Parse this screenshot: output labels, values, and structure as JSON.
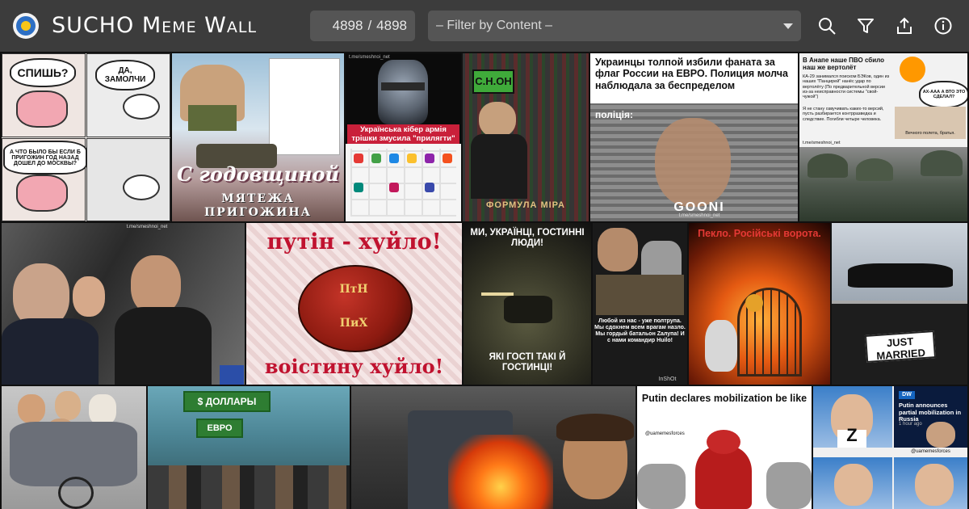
{
  "header": {
    "app_title": "SUCHO Meme Wall",
    "count_shown": "4898",
    "count_separator": "/",
    "count_total": "4898",
    "filter_placeholder": "– Filter by Content –",
    "icons": [
      "search-icon",
      "filter-icon",
      "share-icon",
      "info-icon"
    ]
  },
  "colors": {
    "header_bg": "#3c3c3c",
    "control_bg": "#555555",
    "text": "#ffffff"
  },
  "memes": [
    {
      "id": "brain-sleep",
      "speech_1": "СПИШЬ?",
      "speech_2": "ДА, ЗАМОЛЧИ",
      "speech_3": "А ЧТО БЫЛО БЫ ЕСЛИ Б ПРИГОЖИН ГОД НАЗАД ДОШЕЛ ДО МОСКВЫ?"
    },
    {
      "id": "mutiny-anniversary",
      "caption_1": "С годовщиной",
      "caption_2": "МЯТЕЖА",
      "caption_3": "ПРИГОЖИНА"
    },
    {
      "id": "robocop-army",
      "caption": "Українська кібер армія трішки змусила \"прилягти\"",
      "watermark": "t.me/smeshnoi_net"
    },
    {
      "id": "formula-mira",
      "sign": "С.Н.ОН",
      "caption": "ФОРМУЛА МІРА"
    },
    {
      "id": "euro-fan",
      "caption": "Украинцы толпой избили фаната за флаг России на ЕВРО. Полиция молча наблюдала за беспределом",
      "sub": "поліція:",
      "logo": "GOONI",
      "watermark": "t.me/smeshnoi_net"
    },
    {
      "id": "ka29-helicopter",
      "caption": "В Анапе наше ПВО сбило наш же вертолёт",
      "body": "КА-29 занимался поиском БЭКов, один из наших \"Панцирей\" нанёс удар по вертолёту (По предварительной версии из-за неисправности системы \"свой-чужой\")",
      "body2": "Я не стану озвучивать каких-то версий, пусть разбирается контрразведка и следствие. Погибли четыре человека.",
      "quote": "Вечного полета, братья.",
      "watermark": "t.me/smeshnoi_net",
      "speech": "АХ-ААА А ВТО ЭТО СДЕЛАЛ?"
    },
    {
      "id": "putin-car",
      "watermark": "t.me/smeshnoi_net"
    },
    {
      "id": "easter-egg",
      "caption_top": "путін - хуйло!",
      "egg_text_1": "ПтН",
      "egg_text_2": "ПиХ",
      "caption_bottom": "воістину хуйло!"
    },
    {
      "id": "guests",
      "caption_top": "МИ, УКРАЇНЦІ, ГОСТИННІ ЛЮДИ!",
      "caption_bottom": "ЯКІ ГОСТІ ТАКІ Й ГОСТИНЦІ!"
    },
    {
      "id": "funeral-battalion",
      "caption": "Любой из нас - уже полтрупа. Мы сдохнем всем врагам назло. Мы гордый батальон Zалупа! И с нами командир Huilo!",
      "watermark": "InShOt"
    },
    {
      "id": "hell-gates",
      "caption": "Пекло. Російські ворота."
    },
    {
      "id": "just-married",
      "sign": "JUST MARRIED"
    },
    {
      "id": "dictators-wheelchair"
    },
    {
      "id": "dollars-store",
      "sign_1": "$ ДОЛЛАРЫ",
      "sign_2": "ЕВРО"
    },
    {
      "id": "refinery-fire"
    },
    {
      "id": "mobilization",
      "caption": "Putin declares mobilization be like",
      "handle": "@uamemesforces"
    },
    {
      "id": "partial-mobilization",
      "headline": "Putin announces partial mobilization in Russia",
      "time": "1 hour ago",
      "handle": "@uamemesforces",
      "letter": "Z",
      "channel": "DW"
    }
  ]
}
